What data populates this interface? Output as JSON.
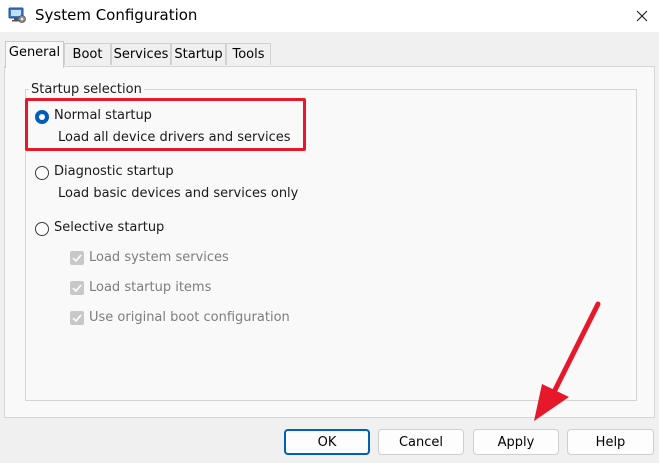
{
  "window": {
    "title": "System Configuration",
    "icon": "system-config-icon",
    "close_icon": "close-icon"
  },
  "tabs": [
    {
      "label": "General",
      "active": true
    },
    {
      "label": "Boot"
    },
    {
      "label": "Services"
    },
    {
      "label": "Startup"
    },
    {
      "label": "Tools"
    }
  ],
  "startup_selection": {
    "group_label": "Startup selection",
    "options": [
      {
        "label": "Normal startup",
        "description": "Load all device drivers and services",
        "selected": true
      },
      {
        "label": "Diagnostic startup",
        "description": "Load basic devices and services only",
        "selected": false
      },
      {
        "label": "Selective startup",
        "selected": false
      }
    ],
    "selective_items": [
      {
        "label": "Load system services",
        "checked": true,
        "disabled": true
      },
      {
        "label": "Load startup items",
        "checked": true,
        "disabled": true
      },
      {
        "label": "Use original boot configuration",
        "checked": true,
        "disabled": true
      }
    ]
  },
  "buttons": {
    "ok": "OK",
    "cancel": "Cancel",
    "apply": "Apply",
    "help": "Help"
  },
  "colors": {
    "accent": "#005fb8",
    "annotation": "#e8182b"
  }
}
